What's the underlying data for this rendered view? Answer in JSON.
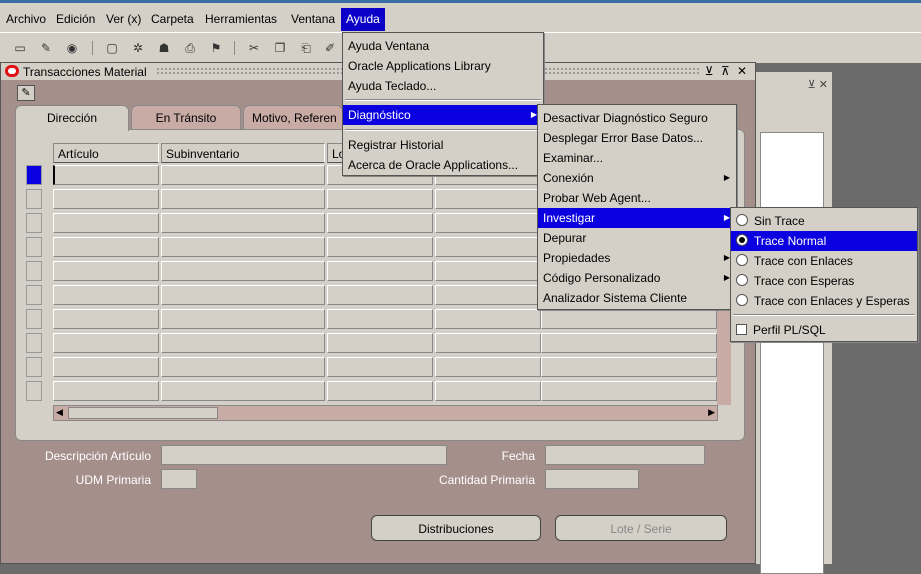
{
  "menubar": {
    "items": [
      "Archivo",
      "Edición",
      "Ver (x)",
      "Carpeta",
      "Herramientas",
      "Ventana",
      "Ayuda"
    ]
  },
  "window": {
    "title": "Transacciones Material",
    "controls": "⊻ ⊼ ✕"
  },
  "tabs": [
    "Dirección",
    "En Tránsito",
    "Motivo, Referen"
  ],
  "table": {
    "columns": [
      "Artículo",
      "Subinventario",
      "Lo"
    ]
  },
  "form": {
    "descripcion_label": "Descripción Artículo",
    "fecha_label": "Fecha",
    "udm_label": "UDM Primaria",
    "cantidad_label": "Cantidad Primaria"
  },
  "buttons": {
    "distribuciones": "Distribuciones",
    "lote_serie": "Lote / Serie"
  },
  "menus": {
    "ayuda": [
      "Ayuda Ventana",
      "Oracle Applications Library",
      "Ayuda Teclado...",
      "Diagnóstico",
      "Registrar Historial",
      "Acerca de Oracle Applications..."
    ],
    "diagnostico": [
      "Desactivar Diagnóstico Seguro",
      "Desplegar Error Base Datos...",
      "Examinar...",
      "Conexión",
      "Probar Web Agent...",
      "Investigar",
      "Depurar",
      "Propiedades",
      "Código Personalizado",
      "Analizador Sistema Cliente"
    ],
    "investigar": [
      "Sin Trace",
      "Trace Normal",
      "Trace con Enlaces",
      "Trace con Esperas",
      "Trace con Enlaces y Esperas",
      "Perfil PL/SQL"
    ]
  },
  "state": {
    "selected_trace": "Trace Normal",
    "perfil_plsql_checked": false,
    "lote_serie_enabled": false
  },
  "colors": {
    "highlight": "#0a00e0",
    "window_bg": "#a58f8b",
    "panel_bg": "#d4d0c8"
  }
}
